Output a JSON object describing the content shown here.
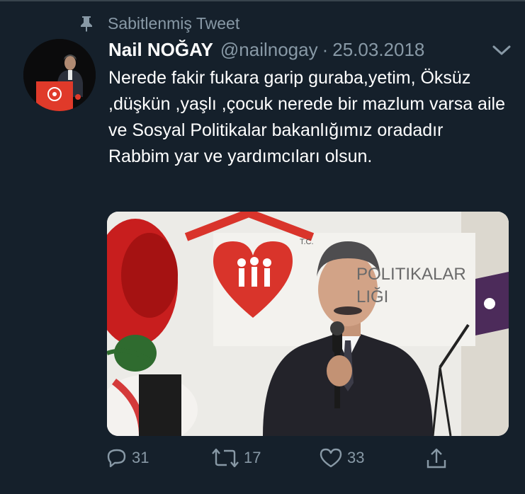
{
  "pinned": {
    "label": "Sabitlenmiş Tweet",
    "icon": "pin-icon"
  },
  "tweet": {
    "author_name": "Nail NOĞAY",
    "handle": "@nailnogay",
    "separator": "·",
    "date": "25.03.2018",
    "text": "Nerede fakir fukara garip guraba,yetim, Öksüz ,düşkün ,yaşlı ,çocuk nerede bir mazlum varsa aile ve Sosyal Politikalar bakanlığımız oradadır Rabbim yar ve yardımcıları olsun.",
    "image": {
      "sign_text_1": "T.C.",
      "sign_text_2": "POLITIKALAR",
      "sign_text_3": "LIĞI"
    }
  },
  "actions": {
    "reply_count": "31",
    "retweet_count": "17",
    "like_count": "33"
  },
  "colors": {
    "background": "#15202b",
    "secondary_text": "#8899a6",
    "primary_text": "#ffffff",
    "divider": "#38444d"
  }
}
